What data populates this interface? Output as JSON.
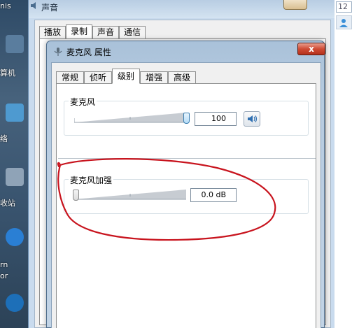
{
  "background": {
    "desktop_labels": [
      "nis",
      "算机",
      "络",
      "收站",
      "rn",
      "or"
    ]
  },
  "sound_window": {
    "title": "声音",
    "tabs": [
      {
        "label": "播放",
        "active": false
      },
      {
        "label": "录制",
        "active": true
      },
      {
        "label": "声音",
        "active": false
      },
      {
        "label": "通信",
        "active": false
      }
    ]
  },
  "right_edge": {
    "box_text": "12"
  },
  "dialog": {
    "title": "麦克风 属性",
    "close_label": "x",
    "tabs": [
      {
        "label": "常规",
        "active": false
      },
      {
        "label": "侦听",
        "active": false
      },
      {
        "label": "级别",
        "active": true
      },
      {
        "label": "增强",
        "active": false
      },
      {
        "label": "高级",
        "active": false
      }
    ],
    "microphone": {
      "label": "麦克风",
      "level": 100,
      "value_text": "100",
      "mute_icon": "speaker-icon"
    },
    "boost": {
      "label": "麦克风加强",
      "level": 0,
      "value_text": "0.0 dB"
    }
  },
  "colors": {
    "annotation_red": "#c8141e",
    "dialog_frame": "#b6cbe0",
    "close_button": "#cf4b34",
    "slider_thumb": "#b4dcf7"
  }
}
